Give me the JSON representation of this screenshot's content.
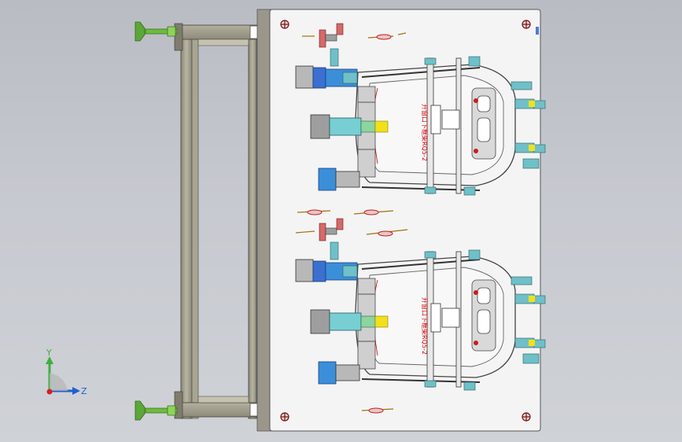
{
  "viewport": {
    "background_top": "#b9bcc3",
    "background_bottom": "#cfd2d7"
  },
  "fixture": {
    "label_upper": "开窗口下框架RQ5-2",
    "label_lower": "开窗口下框架RQ5-2",
    "plate_color": "#f4f4f4",
    "frame_color": "#9e9a8a",
    "support_color": "#7bbf4a"
  },
  "triad": {
    "y_label": "Y",
    "z_label": "Z",
    "y_color": "#3fae3f",
    "z_color": "#1f5fcf",
    "x_color": "#d62020"
  }
}
